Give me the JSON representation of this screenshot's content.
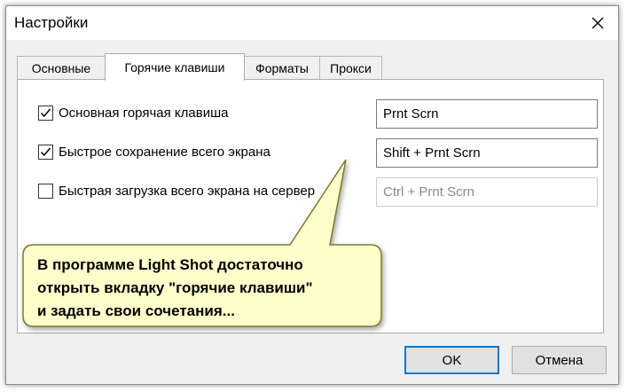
{
  "window": {
    "title": "Настройки"
  },
  "tabs": [
    {
      "label": "Основные"
    },
    {
      "label": "Горячие клавиши"
    },
    {
      "label": "Форматы"
    },
    {
      "label": "Прокси"
    }
  ],
  "hotkeys": [
    {
      "label": "Основная горячая клавиша",
      "checked": true,
      "value": "Prnt Scrn",
      "enabled": true
    },
    {
      "label": "Быстрое сохранение всего экрана",
      "checked": true,
      "value": "Shift + Prnt Scrn",
      "enabled": true
    },
    {
      "label": "Быстрая загрузка всего экрана на сервер",
      "checked": false,
      "value": "Ctrl + Prnt Scrn",
      "enabled": false
    }
  ],
  "callout": {
    "lines": [
      "В программе Light Shot достаточно",
      "открыть вкладку \"горячие клавиши\"",
      "и задать свои сочетания..."
    ],
    "fill": "#ffffcc",
    "border": "#7a7a30"
  },
  "buttons": {
    "ok": "OK",
    "cancel": "Отмена"
  },
  "colors": {
    "accent": "#0078d7",
    "window_bg": "#f0f0f0"
  }
}
